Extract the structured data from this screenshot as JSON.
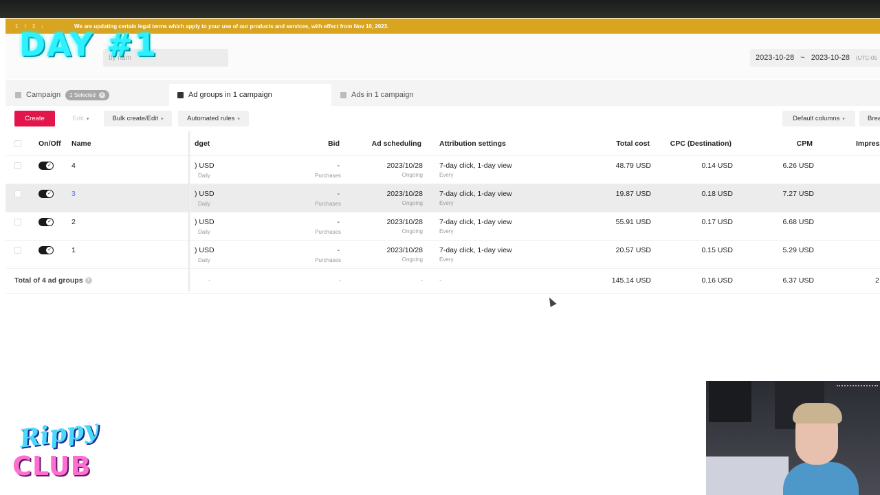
{
  "banner": {
    "pager": [
      "1",
      "/",
      "3",
      "›"
    ],
    "text": "We are updating certain legal terms which apply to your use of our products and services, with effect from Nov 10, 2023."
  },
  "search": {
    "placeholder": "by nam"
  },
  "date_range": {
    "start": "2023-10-28",
    "sep": "~",
    "end": "2023-10-28",
    "tz": "(UTC-05"
  },
  "tabs": {
    "campaign": "Campaign",
    "selected_chip": "1 Selected",
    "ad_groups": "Ad groups in 1 campaign",
    "ads": "Ads in 1 campaign"
  },
  "toolbar": {
    "create": "Create",
    "edit": "Edit",
    "bulk": "Bulk create/Edit",
    "rules": "Automated rules",
    "columns": "Default columns",
    "breakdown": "Brea"
  },
  "columns": {
    "onoff": "On/Off",
    "name": "Name",
    "budget": "dget",
    "bid": "Bid",
    "scheduling": "Ad scheduling",
    "attribution": "Attribution settings",
    "total_cost": "Total cost",
    "cpc": "CPC (Destination)",
    "cpm": "CPM",
    "impressions": "Impress"
  },
  "rows": [
    {
      "name": "4",
      "budget": ") USD",
      "budget_sub": "Daily",
      "bid": "-",
      "bid_sub": "Purchases",
      "sched": "2023/10/28",
      "sched_sub": "Ongoing",
      "attr": "7-day click, 1-day view",
      "attr_sub": "Every",
      "cost": "48.79 USD",
      "cpc": "0.14 USD",
      "cpm": "6.26 USD",
      "imp": ""
    },
    {
      "name": "3",
      "budget": ") USD",
      "budget_sub": "Daily",
      "bid": "-",
      "bid_sub": "Purchases",
      "sched": "2023/10/28",
      "sched_sub": "Ongoing",
      "attr": "7-day click, 1-day view",
      "attr_sub": "Every",
      "cost": "19.87 USD",
      "cpc": "0.18 USD",
      "cpm": "7.27 USD",
      "imp": ""
    },
    {
      "name": "2",
      "budget": ") USD",
      "budget_sub": "Daily",
      "bid": "-",
      "bid_sub": "Purchases",
      "sched": "2023/10/28",
      "sched_sub": "Ongoing",
      "attr": "7-day click, 1-day view",
      "attr_sub": "Every",
      "cost": "55.91 USD",
      "cpc": "0.17 USD",
      "cpm": "6.68 USD",
      "imp": ""
    },
    {
      "name": "1",
      "budget": ") USD",
      "budget_sub": "Daily",
      "bid": "-",
      "bid_sub": "Purchases",
      "sched": "2023/10/28",
      "sched_sub": "Ongoing",
      "attr": "7-day click, 1-day view",
      "attr_sub": "Every",
      "cost": "20.57 USD",
      "cpc": "0.15 USD",
      "cpm": "5.29 USD",
      "imp": ""
    }
  ],
  "total": {
    "label": "Total of 4 ad groups",
    "budget": "-",
    "bid": "-",
    "sched": "-",
    "attr": "-",
    "cost": "145.14 USD",
    "cpc": "0.16 USD",
    "cpm": "6.37 USD",
    "imp": "2"
  },
  "overlay": {
    "title": "DAY #1",
    "logo_top": "Rippy",
    "logo_bottom": "CLUB"
  },
  "colors": {
    "accent": "#e3164b",
    "banner": "#d9a521",
    "link": "#5b6ee8",
    "overlay": "#2ef0ff"
  }
}
